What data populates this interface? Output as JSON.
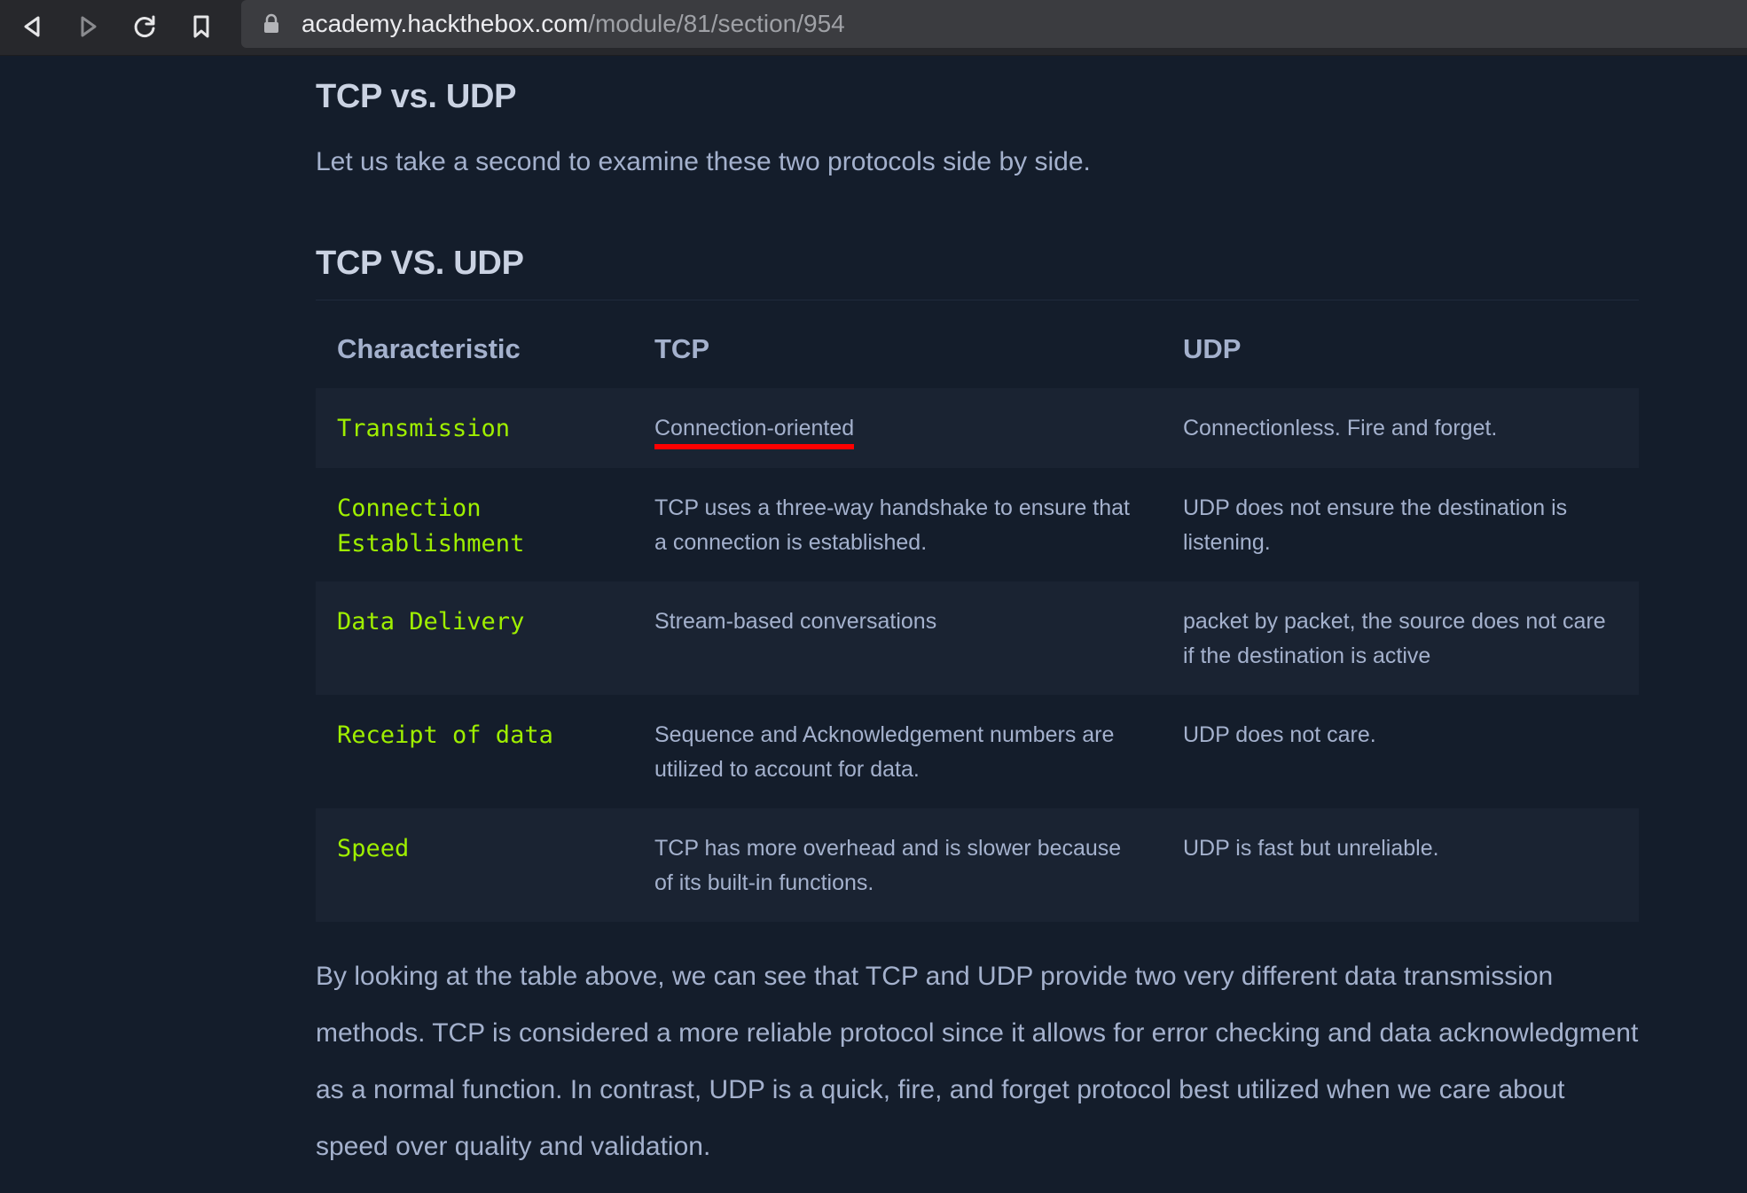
{
  "browser": {
    "url_domain": "academy.hackthebox.com",
    "url_path": "/module/81/section/954",
    "icons": [
      "back-icon",
      "forward-icon",
      "reload-icon",
      "bookmark-icon",
      "lock-icon"
    ]
  },
  "page": {
    "heading": "TCP vs. UDP",
    "intro": "Let us take a second to examine these two protocols side by side.",
    "table_heading": "TCP VS. UDP",
    "table": {
      "headers": [
        "Characteristic",
        "TCP",
        "UDP"
      ],
      "rows": [
        {
          "characteristic": "Transmission",
          "tcp": "Connection-oriented",
          "udp": "Connectionless. Fire and forget."
        },
        {
          "characteristic": "Connection Establishment",
          "tcp": "TCP uses a three-way handshake to ensure that a connection is established.",
          "udp": "UDP does not ensure the destination is listening."
        },
        {
          "characteristic": "Data Delivery",
          "tcp": "Stream-based conversations",
          "udp": "packet by packet, the source does not care if the destination is active"
        },
        {
          "characteristic": "Receipt of data",
          "tcp": "Sequence and Acknowledgement numbers are utilized to account for data.",
          "udp": "UDP does not care."
        },
        {
          "characteristic": "Speed",
          "tcp": "TCP has more overhead and is slower because of its built-in functions.",
          "udp": "UDP is fast but unreliable."
        }
      ]
    },
    "outro": "By looking at the table above, we can see that TCP and UDP provide two very different data transmission methods. TCP is considered a more reliable protocol since it allows for error checking and data acknowledgment as a normal function. In contrast, UDP is a quick, fire, and forget protocol best utilized when we care about speed over quality and validation."
  },
  "colors": {
    "background": "#141d2b",
    "accent_green": "#9fef00",
    "text": "#a4b1cd",
    "highlight_underline": "#ff0000"
  }
}
